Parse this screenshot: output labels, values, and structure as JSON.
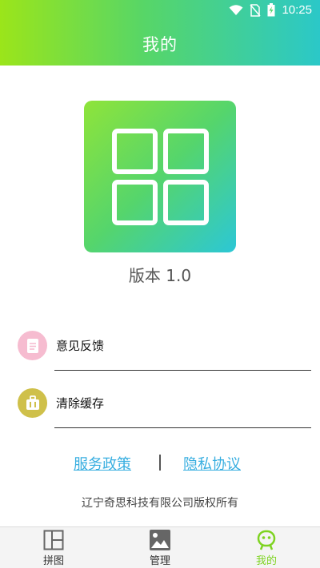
{
  "status_bar": {
    "time": "10:25"
  },
  "header": {
    "title": "我的"
  },
  "app": {
    "version_label": "版本 1.0"
  },
  "menu": [
    {
      "label": "意见反馈",
      "icon": "feedback-icon",
      "icon_color": "#f6bcd0"
    },
    {
      "label": "清除缓存",
      "icon": "clear-cache-icon",
      "icon_color": "#cfc04a"
    }
  ],
  "links": {
    "service_policy": "服务政策",
    "separator": "|",
    "privacy_agreement": "隐私协议"
  },
  "footer": {
    "copyright": "辽宁奇思科技有限公司版权所有"
  },
  "bottom_nav": {
    "items": [
      {
        "label": "拼图",
        "icon": "puzzle-grid-icon",
        "active": false
      },
      {
        "label": "管理",
        "icon": "image-icon",
        "active": false
      },
      {
        "label": "我的",
        "icon": "profile-face-icon",
        "active": true
      }
    ],
    "active_color": "#7ed321"
  },
  "colors": {
    "header_gradient_start": "#9be51a",
    "header_gradient_end": "#2bc8c8",
    "link_color": "#38aee0"
  }
}
